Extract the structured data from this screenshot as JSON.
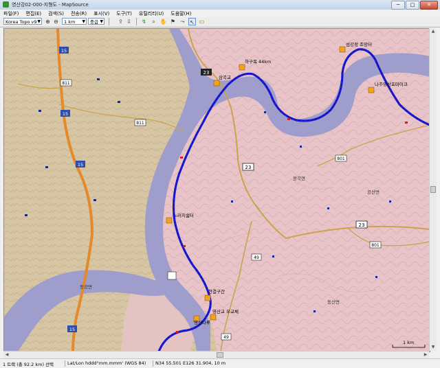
{
  "window": {
    "title": "영산강02-000-지형도 - MapSource",
    "minimize": "─",
    "maximize": "□",
    "close": "✕"
  },
  "menu": [
    "파일(F)",
    "편집(E)",
    "검색(S)",
    "전송(R)",
    "표시(V)",
    "도구(T)",
    "유틸리티(U)",
    "도움말(H)"
  ],
  "toolbar": {
    "map_product": "Korea Topo v9",
    "zoom_scale": "1 km",
    "detail": "중급",
    "icons": [
      "zoom-in-icon",
      "zoom-out-icon",
      "send-to-device-icon",
      "receive-from-device-icon",
      "selection-tool-icon",
      "zoom-tool-icon",
      "hand-tool-icon",
      "waypoint-tool-icon",
      "route-tool-icon",
      "pointer-tool-icon",
      "measure-tool-icon"
    ]
  },
  "map": {
    "shields": {
      "s23a": "23",
      "s23b": "23",
      "s23c": "23",
      "s801a": "801",
      "s801b": "801",
      "s49a": "49",
      "s49b": "49",
      "s811a": "811",
      "s811b": "811",
      "s15a": "15",
      "s15b": "15",
      "s15c": "15",
      "s15d": "15"
    },
    "labels": {
      "wp1": "삼곡교",
      "wp2": "하구목 44km",
      "wp3": "섬강정 조망터",
      "wp4": "나주영산포마이크",
      "wp5": "느러지쉼터",
      "wp6": "한결구간",
      "wp7": "영산교 우교체",
      "wp8": "영산나루",
      "town": "공산면",
      "town2": "동강면",
      "town3": "왕곡면",
      "town4": "동산면"
    },
    "scale_label": "1 km",
    "colors": {
      "river": "#9e9dcc",
      "track": "#1c1cd6",
      "expressway": "#e58a2b",
      "national_road": "#c9a44a",
      "terrain": "#d7c6a4",
      "area": "#e6c3c6"
    }
  },
  "status": {
    "track_info": "1 트랙 (총 92.2 km) 선택",
    "coord_format": "Lat/Lon hddd°mm.mmm' (WGS 84)",
    "coordinates": "N34 55.501 E126 31.904, 10 m"
  }
}
